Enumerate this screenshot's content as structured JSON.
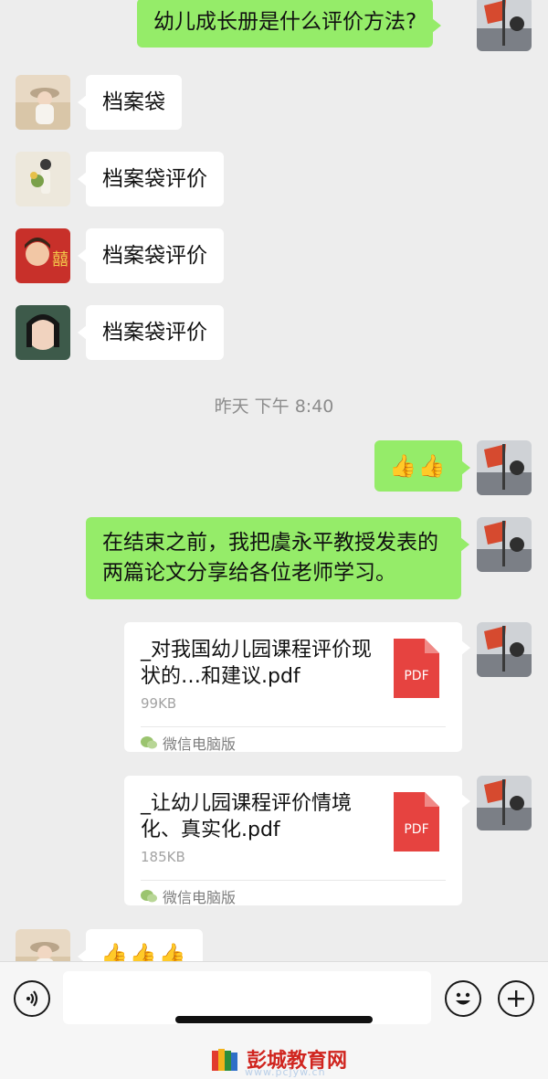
{
  "messages": {
    "m1": "幼儿成长册是什么评价方法?",
    "m2": "档案袋",
    "m3": "档案袋评价",
    "m4": "档案袋评价",
    "m5": "档案袋评价",
    "timestamp": "昨天 下午 8:40",
    "m6": "👍👍",
    "m7": "在结束之前，我把虞永平教授发表的两篇论文分享给各位老师学习。",
    "m9": "👍👍👍"
  },
  "files": [
    {
      "name": "_对我国幼儿园课程评价现状的…和建议.pdf",
      "size": "99KB",
      "source": "微信电脑版",
      "icon_label": "PDF"
    },
    {
      "name": "_让幼儿园课程评价情境化、真实化.pdf",
      "size": "185KB",
      "source": "微信电脑版",
      "icon_label": "PDF"
    }
  ],
  "watermark": {
    "text": "彭城教育网",
    "sub": "www.pcjyw.cn"
  },
  "colors": {
    "bubble_green": "#95ec69",
    "pdf_red": "#e64340",
    "background": "#ededed"
  },
  "icons": [
    "voice-icon",
    "emoji-icon",
    "plus-icon",
    "pdf-icon",
    "wechat-pc-icon",
    "thumbs-up-emoji"
  ]
}
